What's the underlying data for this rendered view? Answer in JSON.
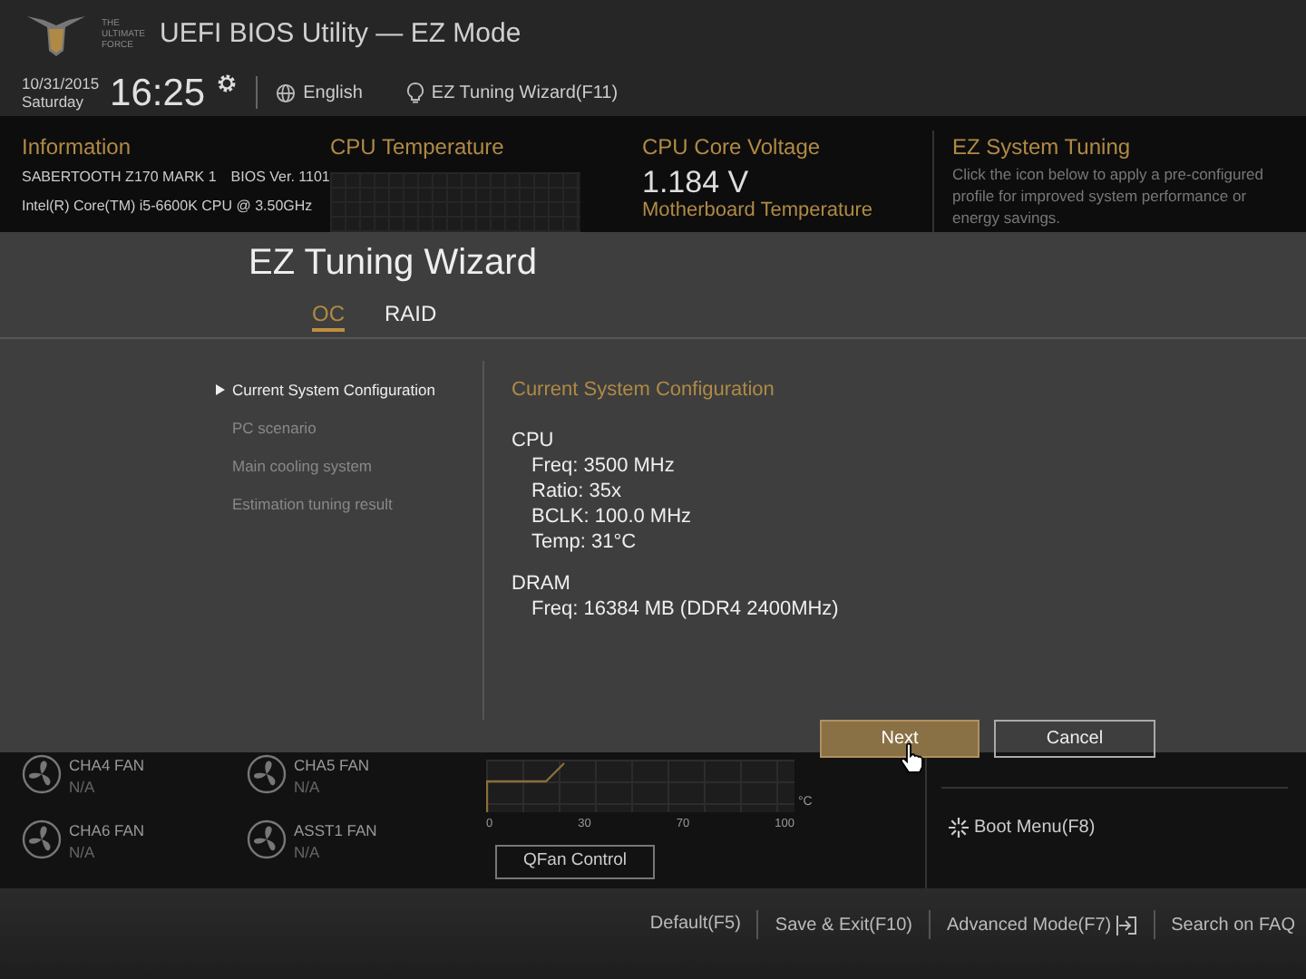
{
  "header": {
    "logo_text": "THE ULTIMATE FORCE",
    "title": "UEFI BIOS Utility — EZ Mode"
  },
  "status_row": {
    "date": "10/31/2015",
    "day": "Saturday",
    "time": "16:25",
    "language": "English",
    "wizard": "EZ Tuning Wizard(F11)"
  },
  "information": {
    "title": "Information",
    "board": "SABERTOOTH Z170 MARK 1",
    "bios": "BIOS Ver. 1101",
    "cpu": "Intel(R) Core(TM) i5-6600K CPU @ 3.50GHz"
  },
  "cpu_temperature": {
    "title": "CPU Temperature"
  },
  "cpu_core_voltage": {
    "title": "CPU Core Voltage",
    "value": "1.184 V",
    "next_title": "Motherboard Temperature"
  },
  "ez_system_tuning": {
    "title": "EZ System Tuning",
    "description": "Click the icon below to apply a pre-configured profile for improved system performance or energy savings."
  },
  "dialog": {
    "title": "EZ Tuning Wizard",
    "tabs": [
      {
        "label": "OC",
        "selected": true
      },
      {
        "label": "RAID",
        "selected": false
      }
    ],
    "steps": [
      {
        "label": "Current System Configuration",
        "selected": true
      },
      {
        "label": "PC scenario",
        "selected": false
      },
      {
        "label": "Main cooling system",
        "selected": false
      },
      {
        "label": "Estimation tuning result",
        "selected": false
      }
    ],
    "content": {
      "heading": "Current System Configuration",
      "groups": [
        {
          "name": "CPU",
          "lines": [
            "Freq: 3500 MHz",
            "Ratio: 35x",
            "BCLK: 100.0 MHz",
            "Temp: 31°C"
          ]
        },
        {
          "name": "DRAM",
          "lines": [
            "Freq: 16384 MB (DDR4 2400MHz)"
          ]
        }
      ]
    },
    "buttons": [
      {
        "label": "Next",
        "kind": "primary"
      },
      {
        "label": "Cancel",
        "kind": "secondary"
      }
    ]
  },
  "fans": [
    {
      "name": "CHA4 FAN",
      "value": "N/A"
    },
    {
      "name": "CHA5 FAN",
      "value": "N/A"
    },
    {
      "name": "CHA6 FAN",
      "value": "N/A"
    },
    {
      "name": "ASST1 FAN",
      "value": "N/A"
    }
  ],
  "fan_chart": {
    "xticks": [
      "0",
      "30",
      "70",
      "100"
    ],
    "unit": "°C"
  },
  "qfan_button": "QFan Control",
  "boot_menu": "Boot Menu(F8)",
  "footer": [
    {
      "label": "Default(F5)",
      "kind": "plain"
    },
    {
      "label": "Save & Exit(F10)",
      "kind": "plain"
    },
    {
      "label": "Advanced Mode(F7)",
      "kind": "exit"
    },
    {
      "label": "Search on FAQ",
      "kind": "plain"
    }
  ]
}
